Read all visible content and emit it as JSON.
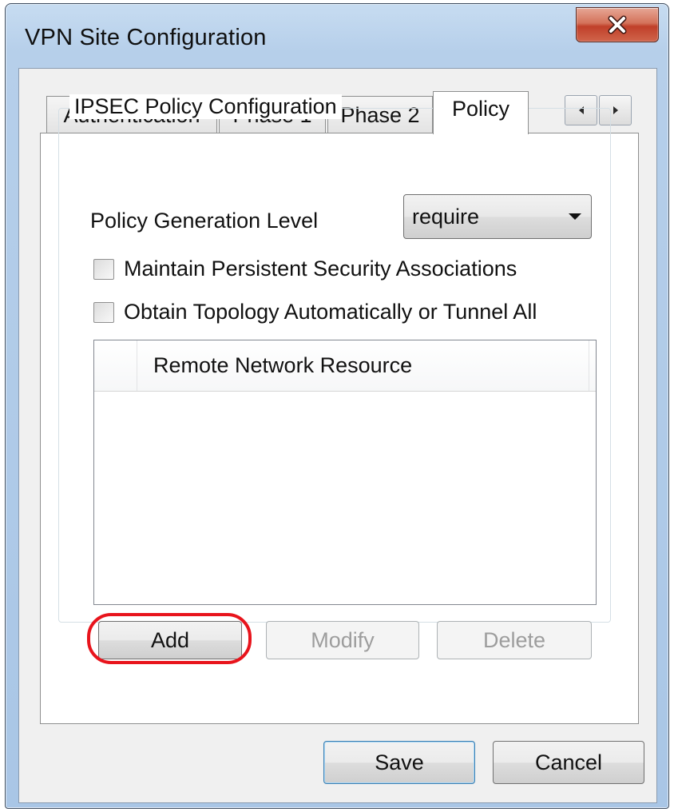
{
  "window": {
    "title": "VPN Site Configuration",
    "close_icon": "close-icon"
  },
  "tabs": [
    {
      "label": "Authentication",
      "active": false
    },
    {
      "label": "Phase 1",
      "active": false
    },
    {
      "label": "Phase 2",
      "active": false
    },
    {
      "label": "Policy",
      "active": true
    }
  ],
  "tab_scroll": {
    "left_icon": "chevron-left-icon",
    "right_icon": "chevron-right-icon"
  },
  "policy": {
    "group_title": "IPSEC Policy Configuration",
    "generation_level_label": "Policy Generation Level",
    "generation_level_value": "require",
    "checkbox_persistent_sa": {
      "label": "Maintain Persistent Security Associations",
      "checked": false
    },
    "checkbox_topology": {
      "label": "Obtain Topology Automatically or Tunnel All",
      "checked": false
    },
    "list": {
      "columns": [
        "Remote Network Resource"
      ],
      "rows": []
    },
    "buttons": {
      "add": "Add",
      "modify": "Modify",
      "delete": "Delete"
    }
  },
  "footer": {
    "save": "Save",
    "cancel": "Cancel"
  },
  "colors": {
    "highlight_ring": "#e8141c",
    "close_button": "#c0402a"
  }
}
